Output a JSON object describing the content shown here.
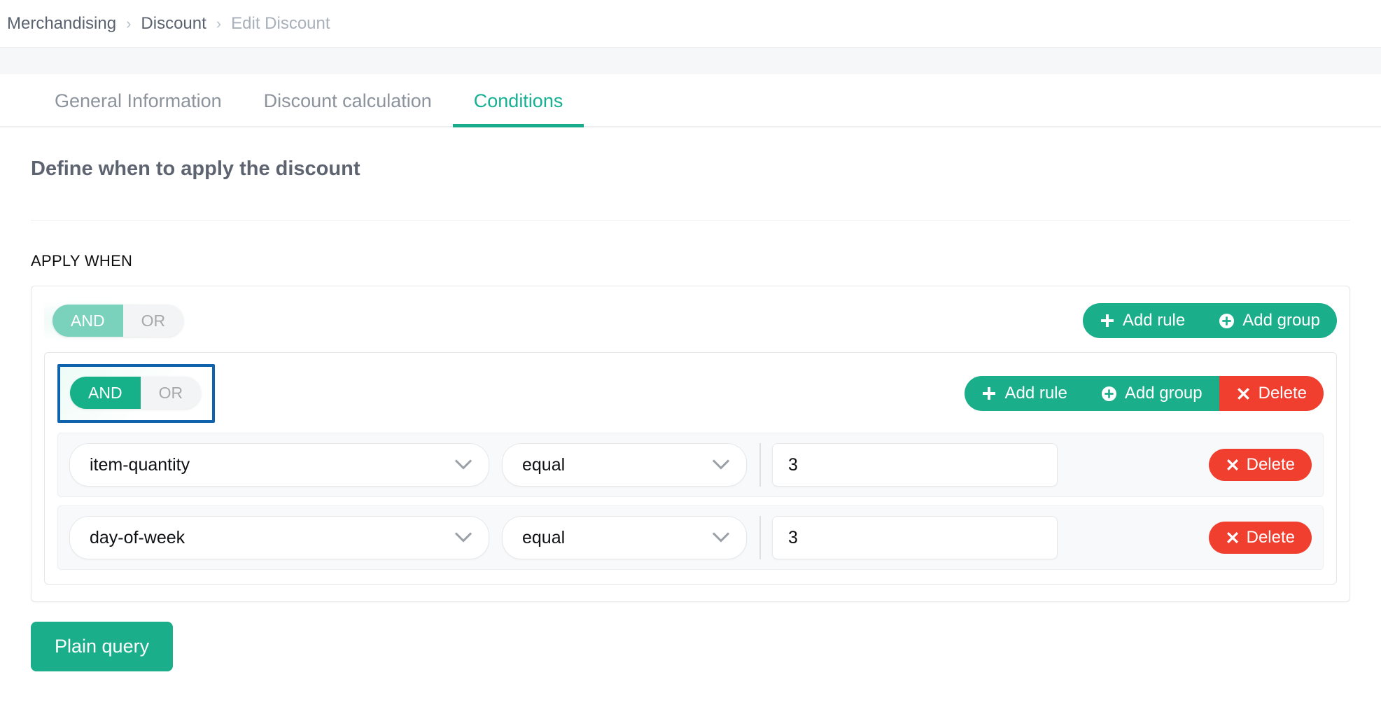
{
  "breadcrumb": {
    "separator": "›",
    "items": [
      {
        "label": "Merchandising",
        "current": false
      },
      {
        "label": "Discount",
        "current": false
      },
      {
        "label": "Edit Discount",
        "current": true
      }
    ]
  },
  "tabs": [
    {
      "label": "General Information",
      "active": false
    },
    {
      "label": "Discount calculation",
      "active": false
    },
    {
      "label": "Conditions",
      "active": true
    }
  ],
  "page": {
    "heading": "Define when to apply the discount",
    "section_label": "APPLY WHEN"
  },
  "query_builder": {
    "outer_group": {
      "toggle": {
        "and_label": "AND",
        "or_label": "OR",
        "selected": "AND"
      },
      "buttons": [
        {
          "label": "Add rule",
          "icon": "plus-icon",
          "color": "#1bae8b"
        },
        {
          "label": "Add group",
          "icon": "plus-circle-icon",
          "color": "#1bae8b"
        }
      ]
    },
    "inner_group": {
      "toggle": {
        "and_label": "AND",
        "or_label": "OR",
        "selected": "AND",
        "focused": true
      },
      "buttons": [
        {
          "label": "Add rule",
          "icon": "plus-icon",
          "color": "#1bae8b"
        },
        {
          "label": "Add group",
          "icon": "plus-circle-icon",
          "color": "#1bae8b"
        },
        {
          "label": "Delete",
          "icon": "times-icon",
          "color": "#f03e2f"
        }
      ],
      "rules": [
        {
          "field": "item-quantity",
          "operator": "equal",
          "value": "3",
          "value_placeholder": "",
          "delete_label": "Delete"
        },
        {
          "field": "day-of-week",
          "operator": "equal",
          "value": "3",
          "value_placeholder": "",
          "delete_label": "Delete"
        }
      ]
    }
  },
  "footer": {
    "plain_query_label": "Plain query"
  },
  "colors": {
    "accent_teal": "#1bae8b",
    "accent_teal_muted": "#7bd2bc",
    "danger_red": "#f03e2f",
    "focus_blue": "#0f62ac",
    "text_muted": "#8c939d"
  }
}
